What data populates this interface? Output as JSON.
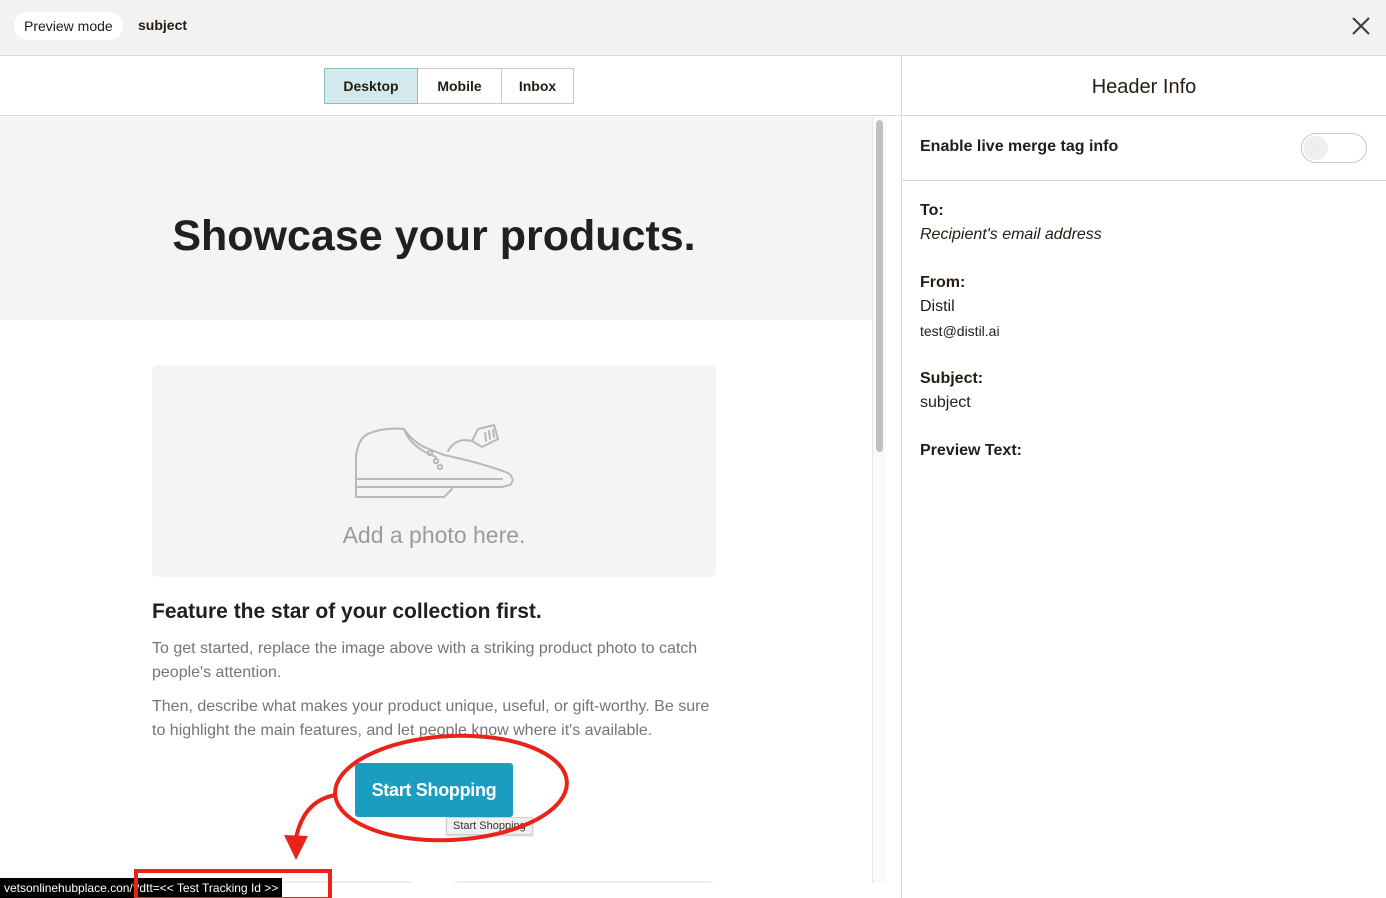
{
  "topbar": {
    "mode_label": "Preview mode",
    "subject": "subject",
    "close_icon": "close-icon"
  },
  "tabs": [
    {
      "label": "Desktop",
      "active": true
    },
    {
      "label": "Mobile",
      "active": false
    },
    {
      "label": "Inbox",
      "active": false
    }
  ],
  "preview": {
    "hero_title": "Showcase your products.",
    "photo_placeholder": "Add a photo here.",
    "photo_icon": "shoe-icon",
    "feature_title": "Feature the star of your collection first.",
    "paragraph_1": "To get started, replace the image above with a striking product photo to catch people's attention.",
    "paragraph_2": "Then, describe what makes your product unique, useful, or gift-worthy. Be sure to highlight the main features, and let people know where it's available.",
    "cta_label": "Start Shopping",
    "cta_tooltip": "Start Shopping",
    "status_url": "vetsonlinehubplace.con/?dtt=<< Test Tracking Id >>"
  },
  "header_info": {
    "title": "Header Info",
    "toggle_label": "Enable live merge tag info",
    "toggle_on": false,
    "to_label": "To:",
    "to_value": "Recipient's email address",
    "from_label": "From:",
    "from_name": "Distil",
    "from_email": "test@distil.ai",
    "subject_label": "Subject:",
    "subject_value": "subject",
    "preview_text_label": "Preview Text:"
  },
  "colors": {
    "cta": "#1a9dc1",
    "active_tab": "#d4e9ec",
    "annotation": "#e8231a"
  }
}
